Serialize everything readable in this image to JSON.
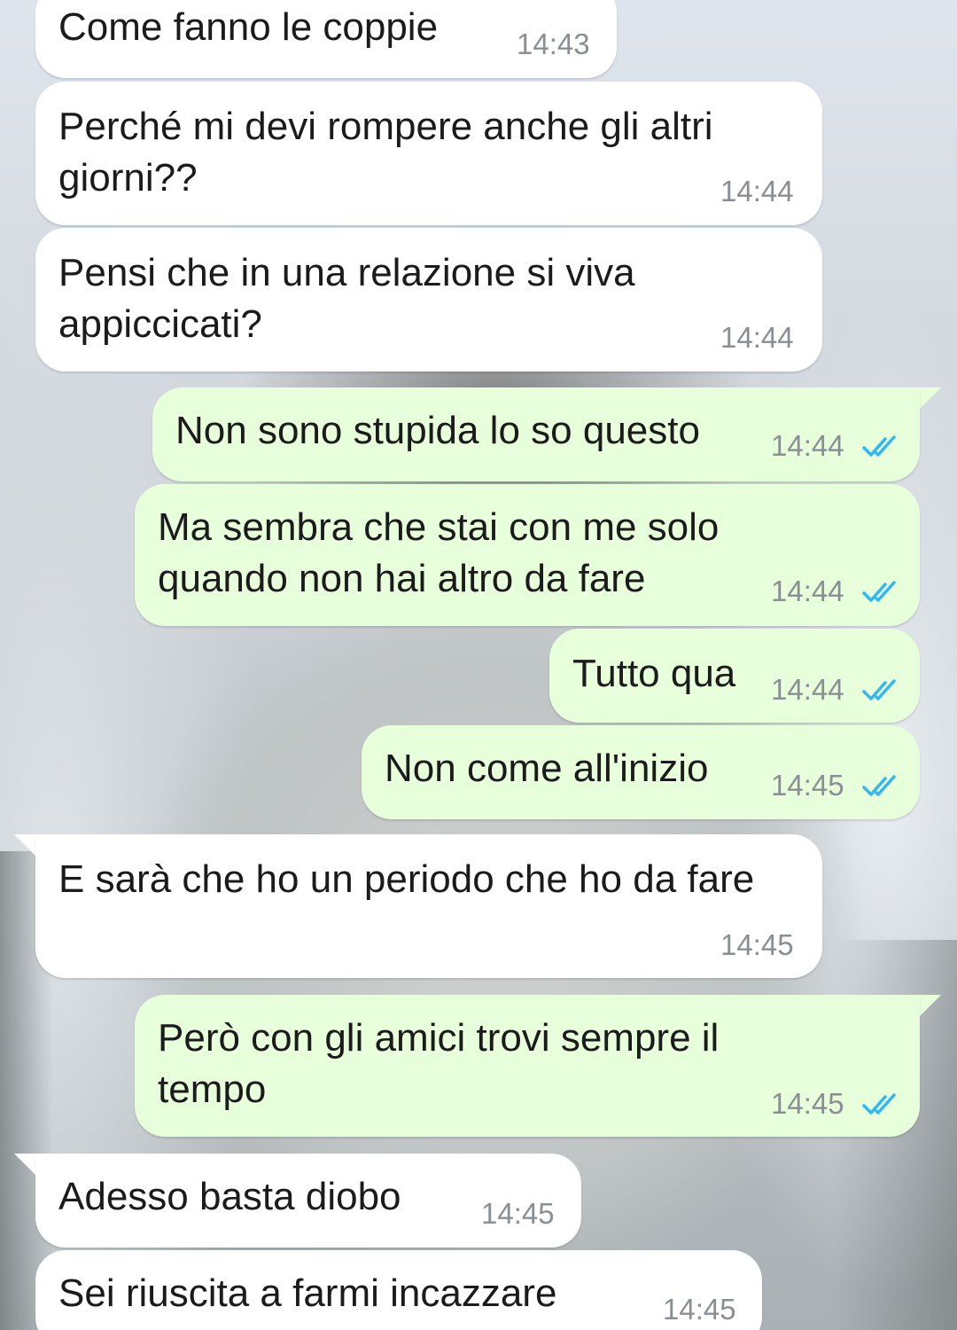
{
  "messages": [
    {
      "direction": "incoming",
      "lines": [
        "Come fanno le coppie"
      ],
      "time": "14:43"
    },
    {
      "direction": "incoming",
      "lines": [
        "Perché mi devi rompere anche gli altri",
        "giorni??"
      ],
      "time": "14:44"
    },
    {
      "direction": "incoming",
      "lines": [
        "Pensi che in una relazione si viva",
        "appiccicati?"
      ],
      "time": "14:44"
    },
    {
      "direction": "outgoing",
      "lines": [
        "Non sono stupida lo so questo"
      ],
      "time": "14:44",
      "status": "read"
    },
    {
      "direction": "outgoing",
      "lines": [
        "Ma sembra che stai con me solo",
        "quando non hai altro da fare"
      ],
      "time": "14:44",
      "status": "read"
    },
    {
      "direction": "outgoing",
      "lines": [
        "Tutto qua"
      ],
      "time": "14:44",
      "status": "read"
    },
    {
      "direction": "outgoing",
      "lines": [
        "Non come all'inizio"
      ],
      "time": "14:45",
      "status": "read"
    },
    {
      "direction": "incoming",
      "lines": [
        "E sarà che ho un periodo che ho da fare"
      ],
      "time": "14:45"
    },
    {
      "direction": "outgoing",
      "lines": [
        "Però con gli amici trovi sempre il",
        "tempo"
      ],
      "time": "14:45",
      "status": "read"
    },
    {
      "direction": "incoming",
      "lines": [
        "Adesso basta diobo"
      ],
      "time": "14:45"
    },
    {
      "direction": "incoming",
      "lines": [
        "Sei riuscita a farmi incazzare"
      ],
      "time": "14:45"
    }
  ],
  "colors": {
    "incoming_bubble": "#ffffff",
    "outgoing_bubble": "#e7ffdb",
    "read_ticks": "#34b7f1",
    "timestamp": "#8a8f94"
  },
  "icons": {
    "read_status": "double-check-icon"
  }
}
